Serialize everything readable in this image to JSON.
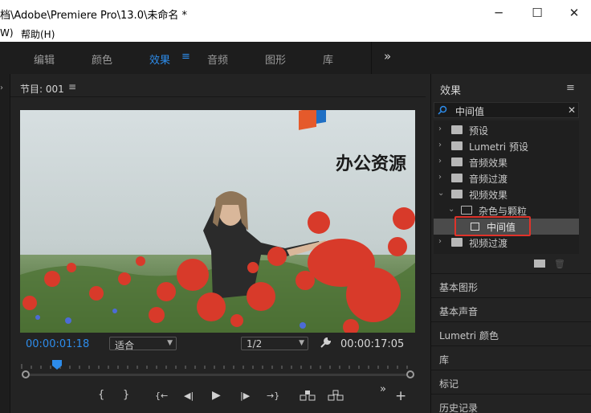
{
  "window": {
    "title": "档\\Adobe\\Premiere Pro\\13.0\\未命名 *",
    "minimize": "─",
    "maximize": "☐",
    "close": "✕"
  },
  "menu": {
    "items": [
      "W)",
      "帮助(H)"
    ]
  },
  "workspaces": {
    "items": [
      "编辑",
      "颜色",
      "效果",
      "音频",
      "图形",
      "库"
    ],
    "active": "效果",
    "more": "»",
    "active_menu": "≡"
  },
  "program": {
    "title": "节目: 001",
    "menu": "≡",
    "timecode_current": "00:00:01:18",
    "fit": "适合",
    "resolution": "1/2",
    "timecode_duration": "00:00:17:05",
    "watermark": "办公资源"
  },
  "transport": {
    "mark_in": "{",
    "mark_out": "}",
    "go_in": "{←",
    "step_back": "◀|",
    "play": "▶",
    "step_fwd": "|▶",
    "go_out": "→}",
    "lift": "⊥",
    "extract": "⊥",
    "more": "»",
    "add": "+"
  },
  "effects": {
    "title": "效果",
    "menu": "≡",
    "search_value": "中间值",
    "clear": "✕",
    "tree": [
      {
        "label": "预设",
        "expanded": false,
        "star": true
      },
      {
        "label": "Lumetri 预设",
        "expanded": false,
        "star": true
      },
      {
        "label": "音频效果",
        "expanded": false
      },
      {
        "label": "音频过渡",
        "expanded": false
      },
      {
        "label": "视频效果",
        "expanded": true
      },
      {
        "label": "杂色与颗粒",
        "expanded": true,
        "indent": 1
      },
      {
        "label": "中间值",
        "selected": true,
        "indent": 2
      },
      {
        "label": "视频过渡",
        "expanded": false
      }
    ],
    "sections": [
      "基本图形",
      "基本声音",
      "Lumetri 颜色",
      "库",
      "标记",
      "历史记录"
    ]
  },
  "colors": {
    "accent": "#2d8ceb",
    "highlight": "#e0332a"
  }
}
